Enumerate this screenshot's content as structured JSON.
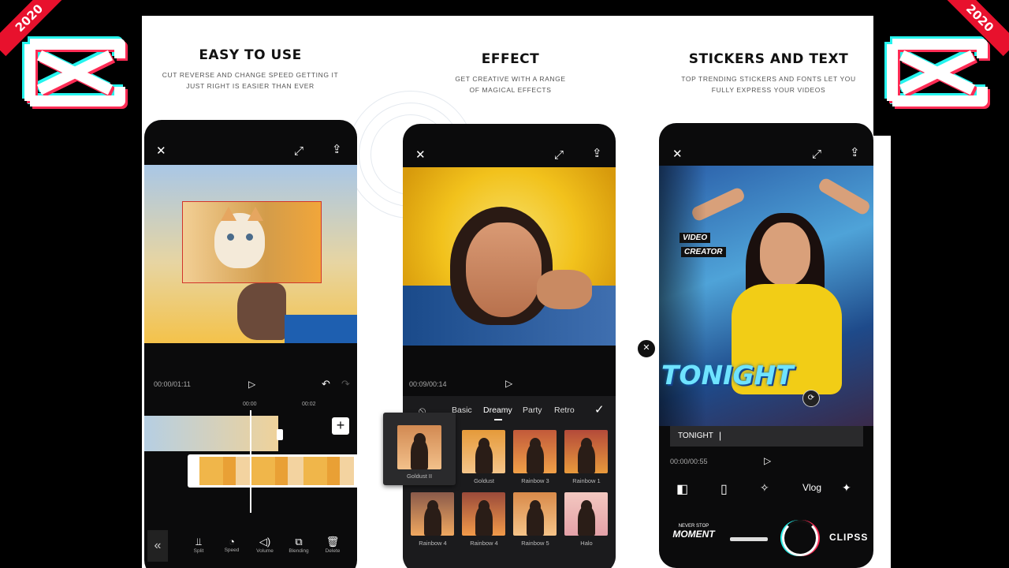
{
  "corner": {
    "year_left": "2020",
    "year_right": "2020"
  },
  "sections": [
    {
      "title": "EASY TO USE",
      "subtitle_l1": "CUT REVERSE AND CHANGE SPEED GETTING IT",
      "subtitle_l2": "JUST RIGHT IS EASIER THAN EVER"
    },
    {
      "title": "EFFECT",
      "subtitle_l1": "GET CREATIVE WITH A RANGE",
      "subtitle_l2": "OF MAGICAL EFFECTS"
    },
    {
      "title": "STICKERS AND TEXT",
      "subtitle_l1": "TOP TRENDING STICKERS AND FONTS LET YOU",
      "subtitle_l2": "FULLY EXPRESS YOUR VIDEOS"
    }
  ],
  "phone1": {
    "timecode": "00:00/01:11",
    "ruler": [
      "00:00",
      "00:02"
    ],
    "tools": [
      {
        "label": "Split",
        "icon": "split-icon"
      },
      {
        "label": "Speed",
        "icon": "speed-icon"
      },
      {
        "label": "Volume",
        "icon": "volume-icon"
      },
      {
        "label": "Blending",
        "icon": "blending-icon"
      },
      {
        "label": "Delete",
        "icon": "delete-icon"
      }
    ]
  },
  "phone2": {
    "timecode": "00:09/00:14",
    "tabs": [
      "Basic",
      "Dreamy",
      "Party",
      "Retro"
    ],
    "active_tab": "Dreamy",
    "filters_row1": [
      "Goldust II",
      "Goldust",
      "Rainbow 3",
      "Rainbow 1"
    ],
    "filters_row2": [
      "Rainbow 4",
      "Rainbow 4",
      "Rainbow 5",
      "Halo"
    ]
  },
  "phone3": {
    "sticker_line1": "VIDEO",
    "sticker_line2": "CREATOR",
    "overlay_text": "TONIGHT",
    "text_input": "TONIGHT",
    "timecode": "00:00/00:55",
    "vlog_label": "Vlog",
    "bottom_sticker_1": "MOMENT",
    "bottom_sticker_1_small": "NEVER STOP",
    "bottom_sticker_3": "CLIPSS"
  },
  "colors": {
    "accent_red": "#e8112d",
    "cyan": "#25f4ee",
    "yellow": "#f5c518"
  }
}
